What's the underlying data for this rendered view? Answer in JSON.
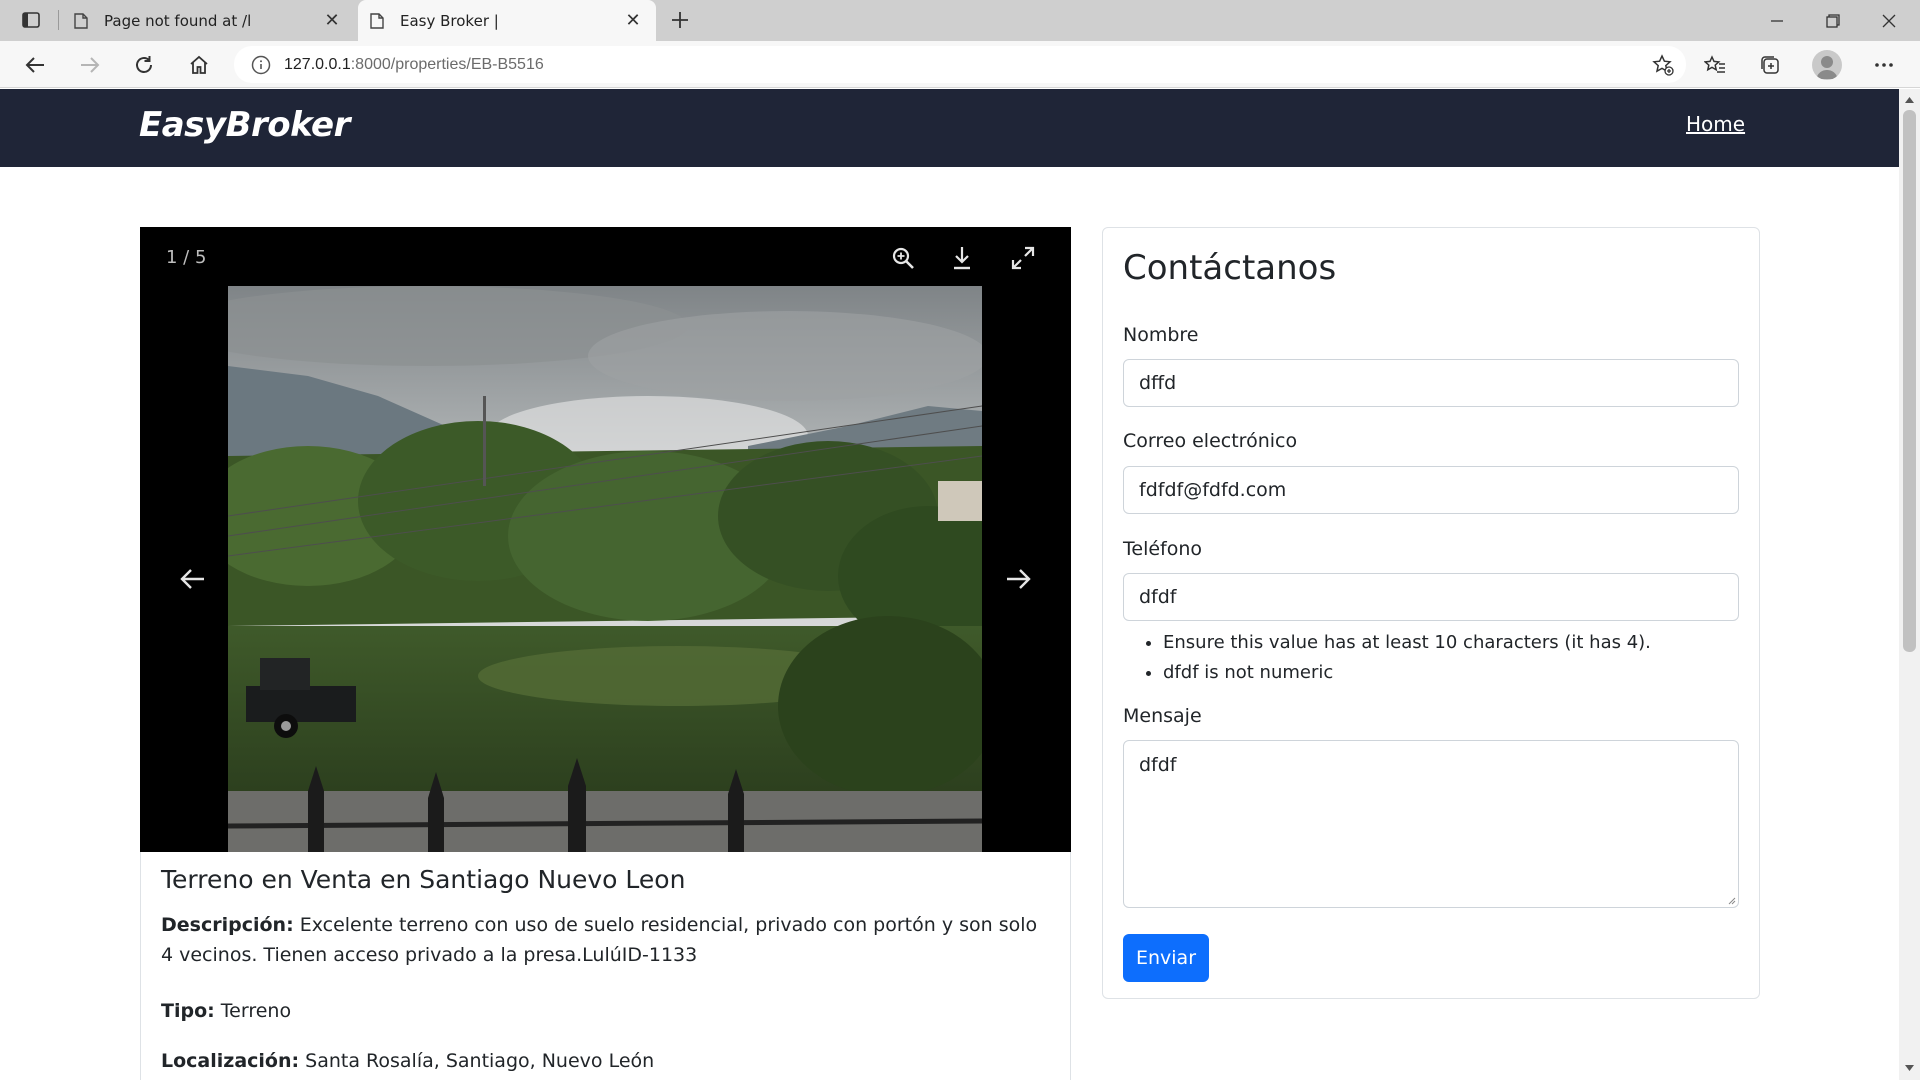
{
  "browser": {
    "tabs": [
      {
        "title": "Page not found at /l",
        "active": false
      },
      {
        "title": "Easy Broker |",
        "active": true
      }
    ],
    "address": {
      "host": "127.0.0.1",
      "rest": ":8000/properties/EB-B5516"
    }
  },
  "nav": {
    "brand": "EasyBroker",
    "home_link": "Home"
  },
  "gallery": {
    "counter": "1 / 5"
  },
  "property": {
    "title": "Terreno en Venta en Santiago Nuevo Leon",
    "description_label": "Descripción:",
    "description": "Excelente terreno con uso de suelo residencial, privado con portón y son solo 4 vecinos. Tienen acceso privado a la presa.LulúID-1133",
    "type_label": "Tipo:",
    "type": "Terreno",
    "location_label": "Localización:",
    "location": "Santa Rosalía, Santiago, Nuevo León"
  },
  "contact": {
    "heading": "Contáctanos",
    "name_label": "Nombre",
    "name_value": "dffd",
    "email_label": "Correo electrónico",
    "email_value": "fdfdf@fdfd.com",
    "phone_label": "Teléfono",
    "phone_value": "dfdf",
    "errors": [
      "Ensure this value has at least 10 characters (it has 4).",
      "dfdf is not numeric"
    ],
    "message_label": "Mensaje",
    "message_value": "dfdf",
    "submit_label": "Enviar"
  },
  "colors": {
    "navbar": "#1f2537",
    "primary_button": "#0d6efd"
  }
}
